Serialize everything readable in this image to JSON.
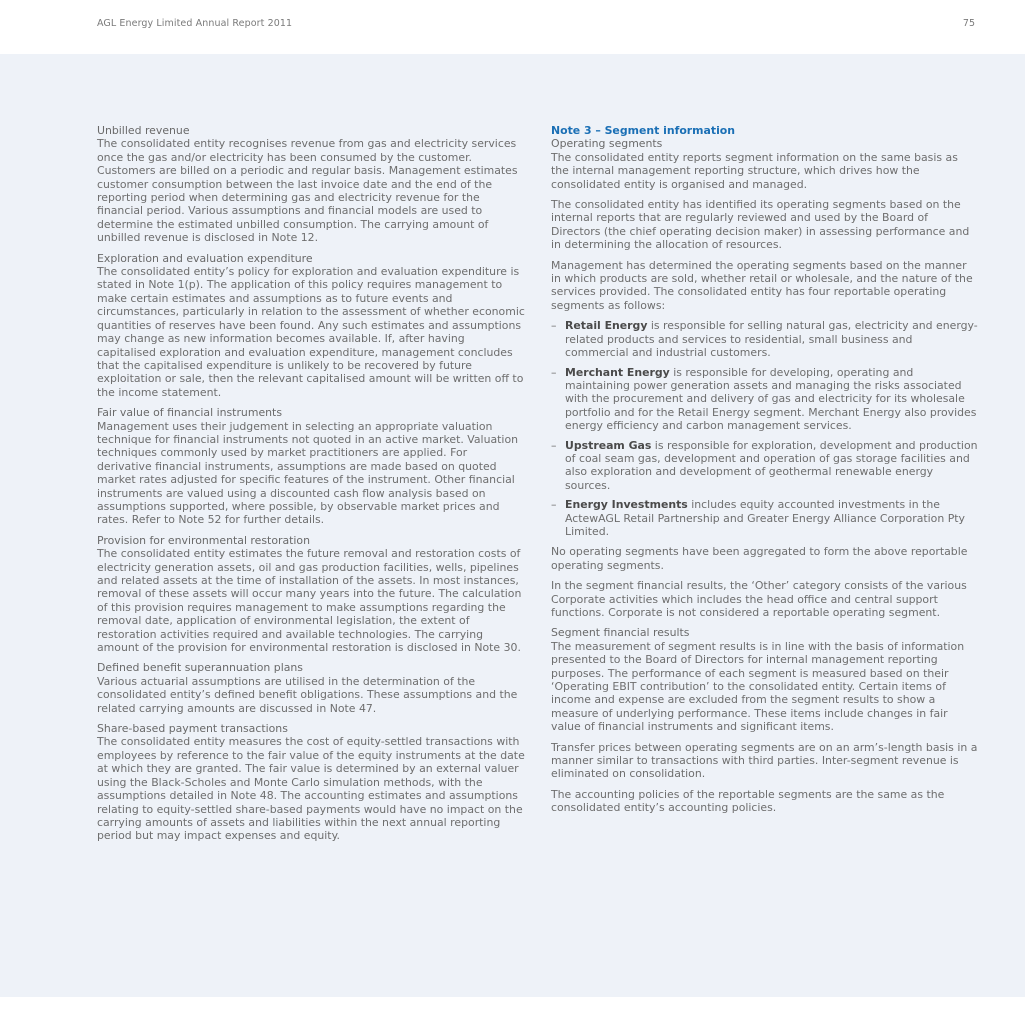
{
  "header": {
    "report_title": "AGL Energy Limited Annual Report 2011",
    "page_number": "75"
  },
  "left_sections": [
    {
      "heading": "Unbilled revenue",
      "text": "The consolidated entity recognises revenue from gas and electricity services once the gas and/or electricity has been consumed by the customer. Customers are billed on a periodic and regular basis. Management estimates customer consumption between the last invoice date and the end of the reporting period when determining gas and electricity revenue for the financial period. Various assumptions and financial models are used to determine the estimated unbilled consumption. The carrying amount of unbilled revenue is disclosed in Note 12."
    },
    {
      "heading": "Exploration and evaluation expenditure",
      "text": "The consolidated entity’s policy for exploration and evaluation expenditure is stated in Note 1(p). The application of this policy requires management to make certain estimates and assumptions as to future events and circumstances, particularly in relation to the assessment of whether economic quantities of reserves have been found. Any such estimates and assumptions may change as new information becomes available. If, after having capitalised exploration and evaluation expenditure, management concludes that the capitalised expenditure is unlikely to be recovered by future exploitation or sale, then the relevant capitalised amount will be written off to the income statement."
    },
    {
      "heading": "Fair value of financial instruments",
      "text": "Management uses their judgement in selecting an appropriate valuation technique for financial instruments not quoted in an active market. Valuation techniques commonly used by market practitioners are applied. For derivative financial instruments, assumptions are made based on quoted market rates adjusted for specific features of the instrument. Other financial instruments are valued using a discounted cash flow analysis based on assumptions supported, where possible, by observable market prices and rates. Refer to Note 52 for further details."
    },
    {
      "heading": "Provision for environmental restoration",
      "text": "The consolidated entity estimates the future removal and restoration costs of electricity generation assets, oil and gas production facilities, wells, pipelines and related assets at the time of installation of the assets. In most instances, removal of these assets will occur many years into the future. The calculation of this provision requires management to make assumptions regarding the removal date, application of environmental legislation, the extent of restoration activities required and available technologies. The carrying amount of the provision for environmental restoration is disclosed in Note 30."
    },
    {
      "heading": "Defined benefit superannuation plans",
      "text": "Various actuarial assumptions are utilised in the determination of the consolidated entity’s defined benefit obligations. These assumptions and the related carrying amounts are discussed in Note 47."
    },
    {
      "heading": "Share-based payment transactions",
      "text": "The consolidated entity measures the cost of equity-settled transactions with employees by reference to the fair value of the equity instruments at the date at which they are granted. The fair value is determined by an external valuer using the Black-Scholes and Monte Carlo simulation methods, with the assumptions detailed in Note 48. The accounting estimates and assumptions relating to equity-settled share-based payments would have no impact on the carrying amounts of assets and liabilities within the next annual reporting period but may impact expenses and equity."
    }
  ],
  "right": {
    "note_title": "Note 3 – Segment information",
    "operating_heading": "Operating segments",
    "paragraphs_1": [
      "The consolidated entity reports segment information on the same basis as the internal management reporting structure, which drives how the consolidated entity is organised and managed.",
      "The consolidated entity has identified its operating segments based on the internal reports that are regularly reviewed and used by the Board of Directors (the chief operating decision maker) in assessing performance and in determining the allocation of resources.",
      "Management has determined the operating segments based on the manner in which products are sold, whether retail or wholesale, and the nature of the services provided. The consolidated entity has four reportable operating segments as follows:"
    ],
    "dash": "–",
    "segments": [
      {
        "name": "Retail Energy",
        "text": " is responsible for selling natural gas, electricity and energy-related products and services to residential, small business and commercial and industrial customers."
      },
      {
        "name": "Merchant Energy",
        "text": " is responsible for developing, operating and maintaining power generation assets and managing the risks associated with the procurement and delivery of gas and electricity for its wholesale portfolio and for the Retail Energy segment. Merchant Energy also provides energy efficiency and carbon management services."
      },
      {
        "name": "Upstream Gas",
        "text": " is responsible for exploration, development and production of coal seam gas, development and operation of gas storage facilities and also exploration and development of geothermal renewable energy sources."
      },
      {
        "name": "Energy Investments",
        "text": " includes equity accounted investments in the ActewAGL Retail Partnership and Greater Energy Alliance Corporation Pty Limited."
      }
    ],
    "paragraphs_2": [
      "No operating segments have been aggregated to form the above reportable operating segments.",
      "In the segment financial results, the ‘Other’ category consists of the various Corporate activities which includes the head office and central support functions. Corporate is not considered a reportable operating segment."
    ],
    "results_heading": "Segment financial results",
    "paragraphs_3": [
      "The measurement of segment results is in line with the basis of information presented to the Board of Directors for internal management reporting purposes. The performance of each segment is measured based on their ‘Operating EBIT contribution’ to the consolidated entity. Certain items of income and expense are excluded from the segment results to show a measure of underlying performance. These items include changes in fair value of financial instruments and significant items.",
      "Transfer prices between operating segments are on an arm’s-length basis in a manner similar to transactions with third parties. Inter-segment revenue is eliminated on consolidation.",
      "The accounting policies of the reportable segments are the same as the consolidated entity’s accounting policies."
    ]
  }
}
